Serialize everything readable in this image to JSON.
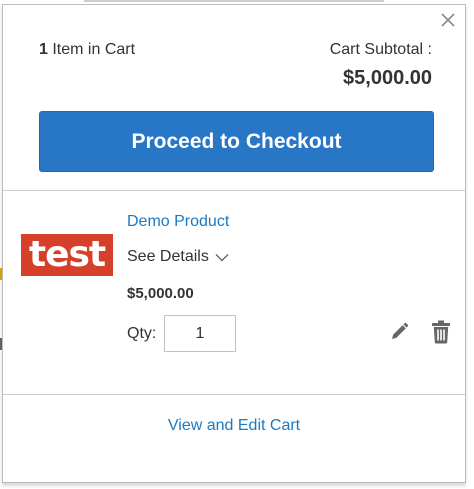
{
  "minicart": {
    "close_symbol": "×",
    "items_count": "1",
    "items_text": "Item in Cart",
    "subtotal_label": "Cart Subtotal :",
    "subtotal_amount": "$5,000.00",
    "checkout_label": "Proceed to Checkout",
    "view_edit_cart": "View and Edit Cart"
  },
  "item": {
    "thumbnail_text": "test",
    "name": "Demo Product",
    "see_details": "See Details",
    "price": "$5,000.00",
    "qty_label": "Qty:",
    "qty_value": "1"
  },
  "icons": {
    "close": "close-icon",
    "details_toggle": "chevron-down-icon",
    "edit": "pencil-icon",
    "delete": "trash-icon"
  },
  "colors": {
    "primary_button": "#2876c6",
    "link": "#1979c3",
    "thumbnail_bg": "#d6402b",
    "text": "#333333"
  }
}
